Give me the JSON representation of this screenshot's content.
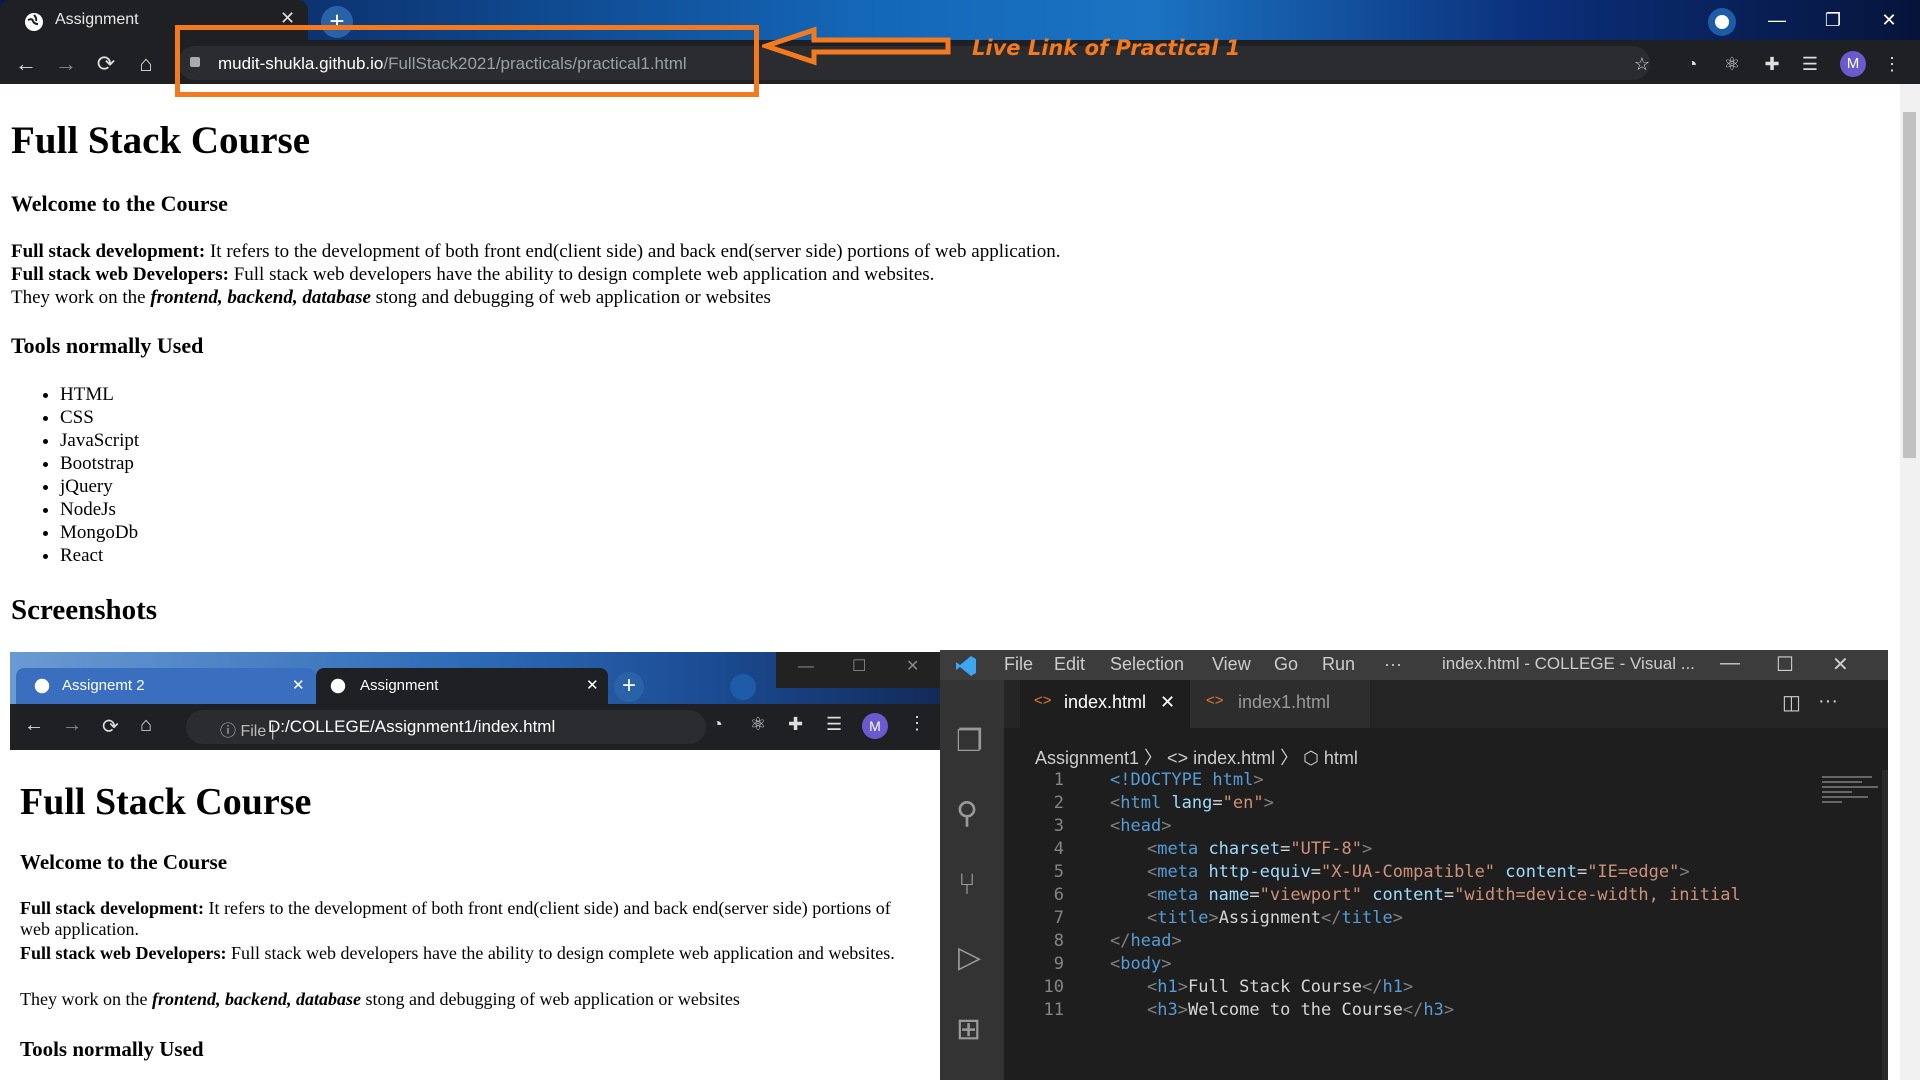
{
  "browser": {
    "tab_title": "Assignment",
    "tab_close": "✕",
    "new_tab": "+",
    "url_host": "mudit-shukla.github.io",
    "url_path": "/FullStack2021/practicals/practical1.html",
    "avatar_letter": "M",
    "window": {
      "minimize": "—",
      "restore": "❐",
      "close": "✕"
    },
    "nav": {
      "back": "←",
      "forward": "→",
      "reload": "⟳",
      "home": "⌂"
    },
    "icons": {
      "star": "☆",
      "ext1": "◔",
      "ext2": "⚛",
      "ext3": "✚",
      "ext4": "☰",
      "menu": "⋮"
    }
  },
  "annotation": {
    "text": "Live Link of Practical 1",
    "color": "#f47a20"
  },
  "page": {
    "h1": "Full Stack Course",
    "h3_welcome": "Welcome to the Course",
    "p1_bold": "Full stack development:",
    "p1_text": " It refers to the development of both front end(client side) and back end(server side) portions of web application.",
    "p2_bold": "Full stack web Developers:",
    "p2_text": " Full stack web developers have the ability to design complete web application and websites.",
    "p3_pre": "They work on the ",
    "p3_em": "frontend, backend, database",
    "p3_post": " stong and debugging of web application or websites",
    "h3_tools": "Tools normally Used",
    "tools": [
      "HTML",
      "CSS",
      "JavaScript",
      "Bootstrap",
      "jQuery",
      "NodeJs",
      "MongoDb",
      "React"
    ],
    "h2_screens": "Screenshots"
  },
  "shot_browser": {
    "tab1": "Assignemt 2",
    "tab2": "Assignment",
    "close": "✕",
    "new_tab": "+",
    "file_label": "ⓘ File |",
    "url": "D:/COLLEGE/Assignment1/index.html",
    "avatar": "M",
    "h1": "Full Stack Course",
    "h3_welcome": "Welcome to the Course",
    "p1_bold": "Full stack development:",
    "p1_text": " It refers to the development of both front end(client side) and back end(server side) portions of web application.",
    "p2_bold": "Full stack web Developers:",
    "p2_text": " Full stack web developers have the ability to design complete web application and websites.",
    "p3_pre": "They work on the ",
    "p3_em": "frontend, backend, database",
    "p3_post": " stong and debugging of web application or websites",
    "h3_tools": "Tools normally Used"
  },
  "vscode": {
    "menu": [
      "File",
      "Edit",
      "Selection",
      "View",
      "Go",
      "Run",
      "···"
    ],
    "title": "index.html - COLLEGE - Visual ...",
    "tab_active": "index.html",
    "tab_inactive": "index1.html",
    "tab_close": "✕",
    "breadcrumb": "Assignment1 〉 <> index.html 〉 ⬡ html",
    "lines": [
      {
        "n": "1"
      },
      {
        "n": "2"
      },
      {
        "n": "3"
      },
      {
        "n": "4"
      },
      {
        "n": "5"
      },
      {
        "n": "6"
      },
      {
        "n": "7"
      },
      {
        "n": "8"
      },
      {
        "n": "9"
      },
      {
        "n": "10"
      },
      {
        "n": "11"
      }
    ],
    "code": {
      "l1": [
        "<!DOCTYPE ",
        "html",
        ">"
      ],
      "l2": [
        "<",
        "html",
        " lang",
        "=",
        "\"en\"",
        ">"
      ],
      "l3": [
        "<",
        "head",
        ">"
      ],
      "l4": [
        "<",
        "meta",
        " charset",
        "=",
        "\"UTF-8\"",
        ">"
      ],
      "l5": [
        "<",
        "meta",
        " http-equiv",
        "=",
        "\"X-UA-Compatible\"",
        " content",
        "=",
        "\"IE=edge\"",
        ">"
      ],
      "l6": [
        "<",
        "meta",
        " name",
        "=",
        "\"viewport\"",
        " content",
        "=",
        "\"width=device-width, initial"
      ],
      "l7": [
        "<",
        "title",
        ">",
        "Assignment",
        "</",
        "title",
        ">"
      ],
      "l8": [
        "</",
        "head",
        ">"
      ],
      "l9": [
        "<",
        "body",
        ">"
      ],
      "l10": [
        "<",
        "h1",
        ">",
        "Full Stack Course",
        "</",
        "h1",
        ">"
      ],
      "l11": [
        "<",
        "h3",
        ">",
        "Welcome to the Course",
        "</",
        "h3",
        ">"
      ]
    }
  }
}
